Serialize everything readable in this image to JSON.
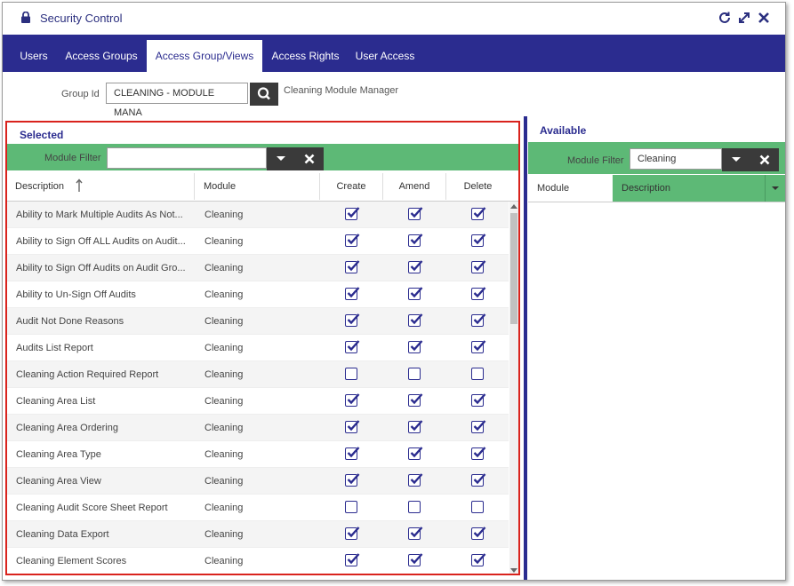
{
  "window": {
    "title": "Security Control"
  },
  "tabs": [
    {
      "label": "Users"
    },
    {
      "label": "Access Groups"
    },
    {
      "label": "Access Group/Views"
    },
    {
      "label": "Access Rights"
    },
    {
      "label": "User Access"
    }
  ],
  "group": {
    "label": "Group Id",
    "value": "CLEANING - MODULE MANA",
    "description": "Cleaning Module Manager"
  },
  "selected": {
    "title": "Selected",
    "filter_label": "Module Filter",
    "filter_value": "",
    "columns": {
      "description": "Description",
      "module": "Module",
      "create": "Create",
      "amend": "Amend",
      "delete": "Delete"
    },
    "rows": [
      {
        "description": "Ability to Mark Multiple Audits As Not...",
        "module": "Cleaning",
        "create": true,
        "amend": true,
        "delete": true
      },
      {
        "description": "Ability to Sign Off ALL Audits on Audit...",
        "module": "Cleaning",
        "create": true,
        "amend": true,
        "delete": true
      },
      {
        "description": "Ability to Sign Off Audits on Audit Gro...",
        "module": "Cleaning",
        "create": true,
        "amend": true,
        "delete": true
      },
      {
        "description": "Ability to Un-Sign Off Audits",
        "module": "Cleaning",
        "create": true,
        "amend": true,
        "delete": true
      },
      {
        "description": "Audit Not Done Reasons",
        "module": "Cleaning",
        "create": true,
        "amend": true,
        "delete": true
      },
      {
        "description": "Audits List Report",
        "module": "Cleaning",
        "create": true,
        "amend": true,
        "delete": true
      },
      {
        "description": "Cleaning Action Required Report",
        "module": "Cleaning",
        "create": false,
        "amend": false,
        "delete": false
      },
      {
        "description": "Cleaning Area List",
        "module": "Cleaning",
        "create": true,
        "amend": true,
        "delete": true
      },
      {
        "description": "Cleaning Area Ordering",
        "module": "Cleaning",
        "create": true,
        "amend": true,
        "delete": true
      },
      {
        "description": "Cleaning Area Type",
        "module": "Cleaning",
        "create": true,
        "amend": true,
        "delete": true
      },
      {
        "description": "Cleaning Area View",
        "module": "Cleaning",
        "create": true,
        "amend": true,
        "delete": true
      },
      {
        "description": "Cleaning Audit Score Sheet Report",
        "module": "Cleaning",
        "create": false,
        "amend": false,
        "delete": false
      },
      {
        "description": "Cleaning Data Export",
        "module": "Cleaning",
        "create": true,
        "amend": true,
        "delete": true
      },
      {
        "description": "Cleaning Element Scores",
        "module": "Cleaning",
        "create": true,
        "amend": true,
        "delete": true
      }
    ]
  },
  "available": {
    "title": "Available",
    "filter_label": "Module Filter",
    "filter_value": "Cleaning",
    "columns": {
      "module": "Module",
      "description": "Description"
    }
  },
  "colors": {
    "brand": "#2b2c8f",
    "filter_green": "#5db976",
    "highlight_red": "#d9231d"
  }
}
